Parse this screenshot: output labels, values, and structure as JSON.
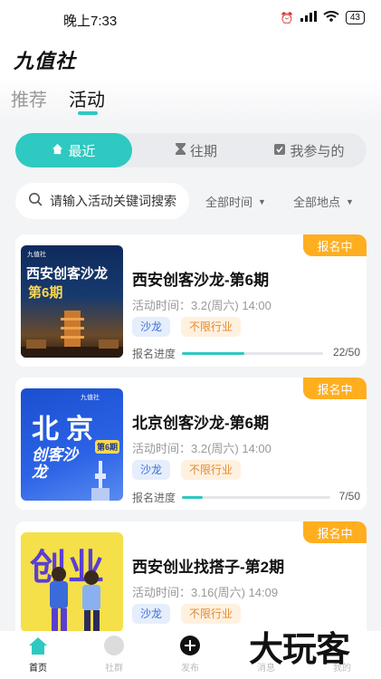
{
  "status_bar": {
    "time": "晚上7:33",
    "battery": "43"
  },
  "app": {
    "logo": "九值社"
  },
  "top_tabs": [
    {
      "label": "推荐"
    },
    {
      "label": "活动"
    }
  ],
  "segments": [
    {
      "label": "最近"
    },
    {
      "label": "往期"
    },
    {
      "label": "我参与的"
    }
  ],
  "search": {
    "placeholder": "请输入活动关键词搜索"
  },
  "filters": {
    "time": "全部时间",
    "location": "全部地点"
  },
  "events": [
    {
      "badge": "报名中",
      "title": "西安创客沙龙-第6期",
      "time": "活动时间：3.2(周六) 14:00",
      "tags": [
        "沙龙",
        "不限行业"
      ],
      "progress_label": "报名进度",
      "progress": 0.44,
      "count": "22/50",
      "poster": {
        "brand": "九值社",
        "line1": "西安创客沙龙",
        "line2": "第6期"
      }
    },
    {
      "badge": "报名中",
      "title": "北京创客沙龙-第6期",
      "time": "活动时间：3.2(周六) 14:00",
      "tags": [
        "沙龙",
        "不限行业"
      ],
      "progress_label": "报名进度",
      "progress": 0.14,
      "count": "7/50",
      "poster": {
        "brand": "九值社",
        "line1": "北京",
        "line2": "创客沙龙",
        "issue": "第6期"
      }
    },
    {
      "badge": "报名中",
      "title": "西安创业找搭子-第2期",
      "time": "活动时间：3.16(周六) 14:09",
      "tags": [
        "沙龙",
        "不限行业"
      ],
      "poster": {
        "line1": "创业"
      }
    }
  ],
  "bottom_nav": [
    {
      "label": "首页"
    },
    {
      "label": "社群"
    },
    {
      "label": "发布"
    },
    {
      "label": "消息"
    },
    {
      "label": "我的"
    }
  ],
  "watermark": "大玩客",
  "colors": {
    "accent": "#2ec9c1",
    "badge": "#ffae1f"
  }
}
